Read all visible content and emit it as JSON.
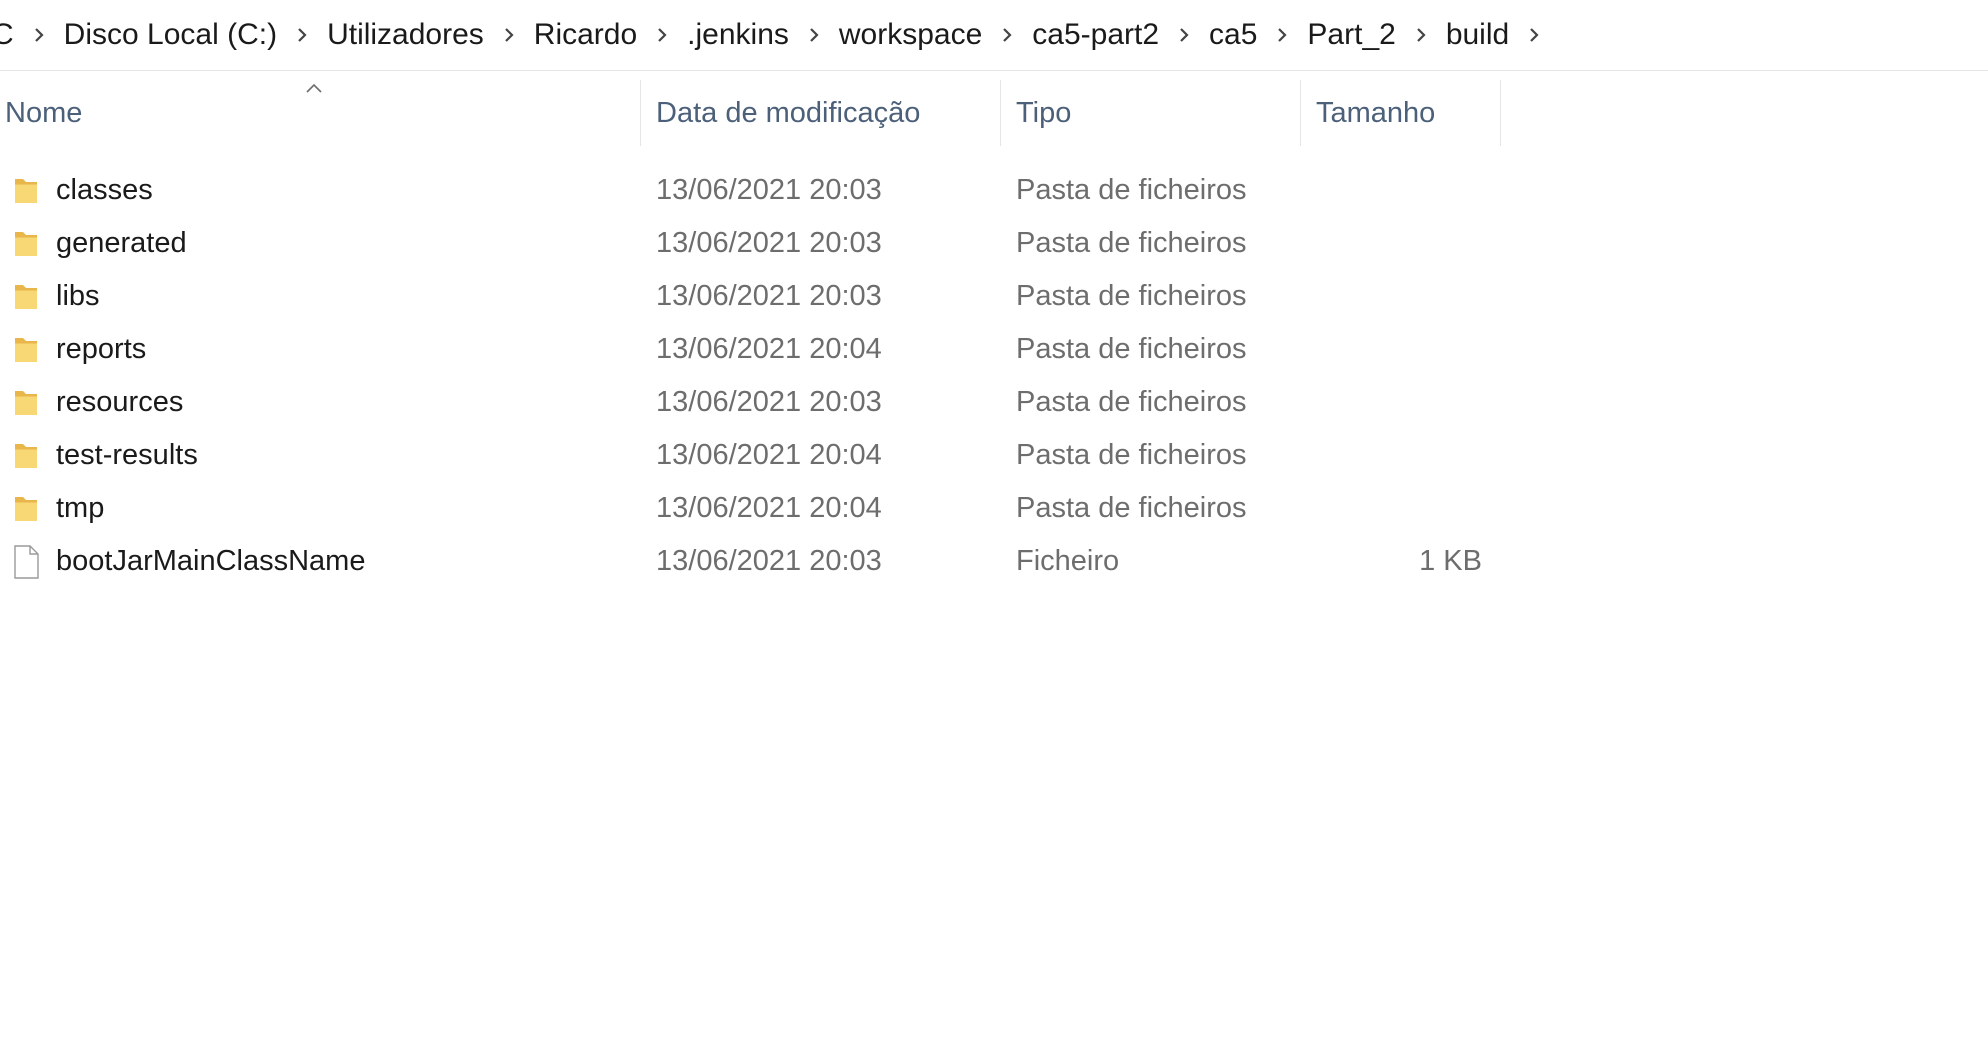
{
  "breadcrumb": {
    "partial_first": "C",
    "segments": [
      "Disco Local (C:)",
      "Utilizadores",
      "Ricardo",
      ".jenkins",
      "workspace",
      "ca5-part2",
      "ca5",
      "Part_2",
      "build"
    ]
  },
  "columns": {
    "name": "Nome",
    "modified": "Data de modificação",
    "type": "Tipo",
    "size": "Tamanho"
  },
  "sort": {
    "column": "name",
    "direction": "ascending",
    "icon": "chevron-up-icon"
  },
  "files": [
    {
      "name": "classes",
      "modified": "13/06/2021 20:03",
      "type": "Pasta de ficheiros",
      "size": "",
      "icon": "folder-icon"
    },
    {
      "name": "generated",
      "modified": "13/06/2021 20:03",
      "type": "Pasta de ficheiros",
      "size": "",
      "icon": "folder-icon"
    },
    {
      "name": "libs",
      "modified": "13/06/2021 20:03",
      "type": "Pasta de ficheiros",
      "size": "",
      "icon": "folder-icon"
    },
    {
      "name": "reports",
      "modified": "13/06/2021 20:04",
      "type": "Pasta de ficheiros",
      "size": "",
      "icon": "folder-icon"
    },
    {
      "name": "resources",
      "modified": "13/06/2021 20:03",
      "type": "Pasta de ficheiros",
      "size": "",
      "icon": "folder-icon"
    },
    {
      "name": "test-results",
      "modified": "13/06/2021 20:04",
      "type": "Pasta de ficheiros",
      "size": "",
      "icon": "folder-icon"
    },
    {
      "name": "tmp",
      "modified": "13/06/2021 20:04",
      "type": "Pasta de ficheiros",
      "size": "",
      "icon": "folder-icon"
    },
    {
      "name": "bootJarMainClassName",
      "modified": "13/06/2021 20:03",
      "type": "Ficheiro",
      "size": "1 KB",
      "icon": "file-icon"
    }
  ],
  "colors": {
    "header_text": "#4c607a",
    "secondary_text": "#6d6d6d",
    "folder_yellow": "#f8d775"
  }
}
